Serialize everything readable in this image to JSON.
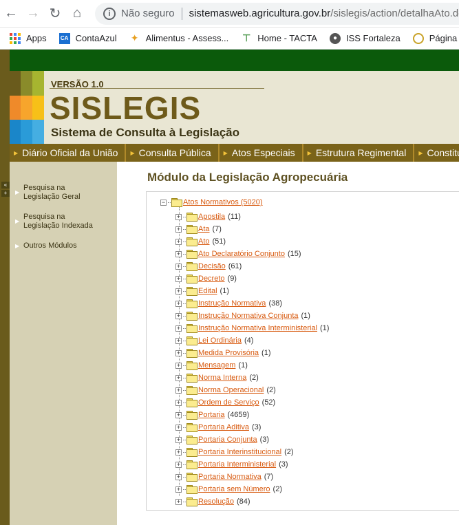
{
  "browser": {
    "security_label": "Não seguro",
    "url_host": "sistemasweb.agricultura.gov.br",
    "url_path": "/sislegis/action/detalhaAto.do?met",
    "bookmarks": [
      {
        "label": "Apps",
        "icon": "apps-grid-icon"
      },
      {
        "label": "ContaAzul",
        "icon": "contaazul-icon",
        "badge": "CA"
      },
      {
        "label": "Alimentus - Assess...",
        "icon": "flame-icon"
      },
      {
        "label": "Home - TACTA",
        "icon": "tacta-icon"
      },
      {
        "label": "ISS Fortaleza",
        "icon": "globe-icon"
      },
      {
        "label": "Página Inicial —",
        "icon": "seal-icon"
      }
    ]
  },
  "header": {
    "version": "VERSÃO 1.0",
    "brand": "SISLEGIS",
    "subtitle": "Sistema de Consulta à Legislação"
  },
  "menu": [
    "Diário Oficial da União",
    "Consulta Pública",
    "Atos Especiais",
    "Estrutura Regimental",
    "Constituições"
  ],
  "sidebar": {
    "items": [
      "Pesquisa na Legislação Geral",
      "Pesquisa na Legislação Indexada",
      "Outros Módulos"
    ]
  },
  "content": {
    "title": "Módulo da Legislação Agropecuária",
    "root_label": "Atos Normativos (5020)",
    "tree": [
      {
        "label": "Apostila",
        "count": "(11)"
      },
      {
        "label": "Ata",
        "count": "(7)"
      },
      {
        "label": "Ato",
        "count": "(51)"
      },
      {
        "label": "Ato Declaratório Conjunto",
        "count": "(15)"
      },
      {
        "label": "Decisão",
        "count": "(61)"
      },
      {
        "label": "Decreto",
        "count": "(9)"
      },
      {
        "label": "Edital",
        "count": "(1)"
      },
      {
        "label": "Instrução Normativa",
        "count": "(38)"
      },
      {
        "label": "Instrução Normativa Conjunta",
        "count": "(1)"
      },
      {
        "label": "Instrução Normativa Interministerial",
        "count": "(1)"
      },
      {
        "label": "Lei Ordinária",
        "count": "(4)"
      },
      {
        "label": "Medida Provisória",
        "count": "(1)"
      },
      {
        "label": "Mensagem",
        "count": "(1)"
      },
      {
        "label": "Norma Interna",
        "count": "(2)"
      },
      {
        "label": "Norma Operacional",
        "count": "(2)"
      },
      {
        "label": "Ordem de Serviço",
        "count": "(52)"
      },
      {
        "label": "Portaria",
        "count": "(4659)"
      },
      {
        "label": "Portaria Aditiva",
        "count": "(3)"
      },
      {
        "label": "Portaria Conjunta",
        "count": "(3)"
      },
      {
        "label": "Portaria Interinstitucional",
        "count": "(2)"
      },
      {
        "label": "Portaria Interministerial",
        "count": "(3)"
      },
      {
        "label": "Portaria Normativa",
        "count": "(7)"
      },
      {
        "label": "Portaria sem Número",
        "count": "(2)"
      },
      {
        "label": "Resolução",
        "count": "(84)"
      }
    ]
  },
  "colors": {
    "accent_green": "#0b5a0b",
    "menu_bg": "#7a6319",
    "link": "#d85a0f",
    "sidebar_bg": "#d6d1b4"
  }
}
